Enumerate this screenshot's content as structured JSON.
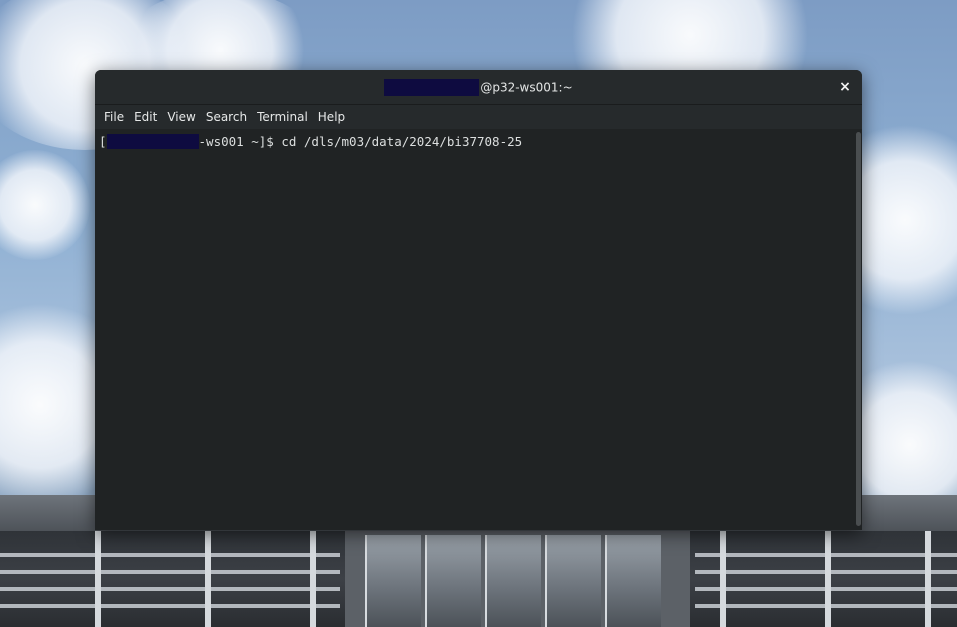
{
  "window": {
    "title": "@p32-ws001:~",
    "close_glyph": "×"
  },
  "menu": {
    "items": [
      "File",
      "Edit",
      "View",
      "Search",
      "Terminal",
      "Help"
    ]
  },
  "terminal": {
    "prompt_open": "[",
    "prompt_host": "-ws001 ~]$ ",
    "command": "cd /dls/m03/data/2024/bi37708-25"
  },
  "colors": {
    "terminal_bg": "#202324",
    "titlebar_bg": "#262a2c",
    "redaction": "#0e0b40",
    "text": "#dcdfdf"
  }
}
